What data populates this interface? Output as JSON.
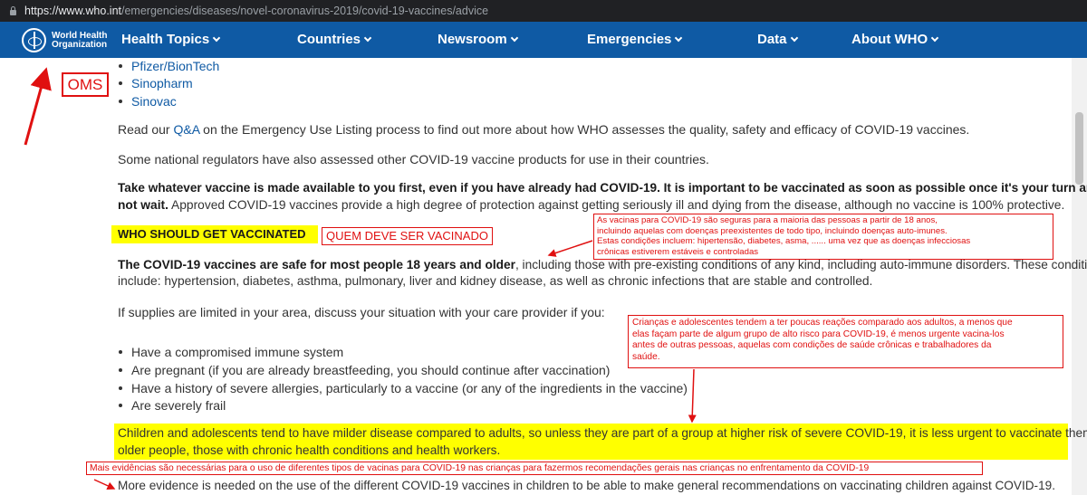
{
  "browser": {
    "url_host": "https://www.who.int",
    "url_path": "/emergencies/diseases/novel-coronavirus-2019/covid-19-vaccines/advice"
  },
  "nav": {
    "logo_line1": "World Health",
    "logo_line2": "Organization",
    "items": [
      "Health Topics",
      "Countries",
      "Newsroom",
      "Emergencies",
      "Data",
      "About WHO"
    ]
  },
  "vaccine_list": [
    "Pfizer/BionTech",
    "Sinopharm",
    "Sinovac"
  ],
  "para_qa": {
    "pre": "Read our ",
    "link": "Q&A",
    "post": " on the Emergency Use Listing process to find out more about how WHO assesses the quality, safety and efficacy of COVID-19 vaccines."
  },
  "para_regulators": "Some national regulators have also assessed other COVID-19 vaccine products for use in their countries.",
  "para_take": {
    "bold_line1": "Take whatever vaccine is made available to you first, even if you have already had COVID-19. It is important to be vaccinated as soon as possible once it's your turn and",
    "bold_line2": "not wait.",
    "rest": " Approved COVID-19 vaccines provide a high degree of protection against getting seriously ill and dying from the disease, although no vaccine is 100% protective."
  },
  "heading_who": "WHO SHOULD GET VACCINATED",
  "annotation_quem": "QUEM DEVE SER VACINADO",
  "annotation_oms": "OMS",
  "annotation_adultos": [
    "As vacinas para COVID-19 são seguras para a maioria das pessoas a partir de 18 anos,",
    "incluindo aquelas com doenças preexistentes de todo tipo, incluindo doenças auto-imunes.",
    "Estas condições incluem: hipertensão, diabetes, asma, ...... uma vez que as doenças infecciosas",
    "crônicas estiverem estáveis e controladas"
  ],
  "para_safe": {
    "bold": "The COVID-19 vaccines are safe for most people 18 years and older",
    "line1_rest": ", including those with pre-existing conditions of any kind, including auto-immune disorders. These conditions",
    "line2": "include: hypertension, diabetes, asthma, pulmonary, liver and kidney disease, as well as chronic infections that are stable and controlled."
  },
  "para_supplies": "If supplies are limited in your area, discuss your situation with your care provider if you:",
  "annotation_criancas": [
    "Crianças e adolescentes tendem a ter poucas reações comparado aos adultos, a menos que",
    "elas façam parte de algum grupo de alto risco para COVID-19, é menos urgente vacina-los",
    "antes de outras pessoas, aquelas com condições de saúde crônicas e trabalhadores da",
    "saúde."
  ],
  "conditions": [
    "Have a compromised immune system",
    "Are pregnant (if you are already breastfeeding, you should continue after vaccination)",
    "Have a history of severe allergies, particularly to a vaccine (or any of the ingredients in the vaccine)",
    "Are severely frail"
  ],
  "para_children": {
    "line1": "Children and adolescents tend to have milder disease compared to adults, so unless they are part of a group at higher risk of severe COVID-19, it is less urgent to vaccinate them than",
    "line2": "older people, those with chronic health conditions and health workers."
  },
  "annotation_evidencias": "Mais evidências são necessárias para o uso de diferentes tipos de vacinas para COVID-19 nas crianças para fazermos recomendações gerais nas crianças no enfrentamento da COVID-19",
  "para_evidence": "More evidence is needed on the use of the different COVID-19 vaccines in children to be able to make general recommendations on vaccinating children against COVID-19.",
  "colors": {
    "nav_bg": "#0f5aa4",
    "annotation_red": "#e01010",
    "highlight_yellow": "#ffff00",
    "link_blue": "#0f5aa4"
  }
}
